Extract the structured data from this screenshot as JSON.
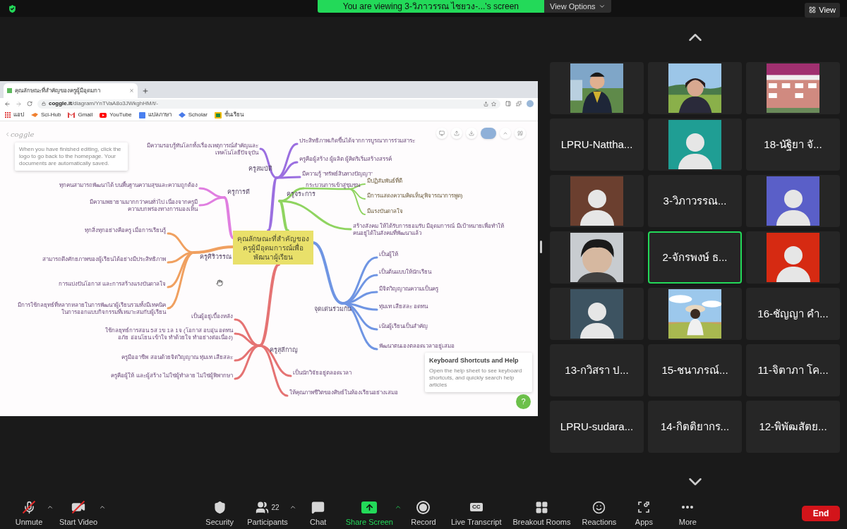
{
  "top_bar": {
    "banner": "You are viewing 3-วิภาวรรณ ไชยวง-...'s screen",
    "view_options": "View Options",
    "view": "View"
  },
  "browser": {
    "tab_title": "คุณลักษณะที่สำคัญของครูผู้มีอุดมกา",
    "url_host": "coggle.it",
    "url_path": "/diagram/YnTVaA8o3JWkghHM/t/-",
    "bookmarks": [
      {
        "kind": "apps",
        "label": "แอป"
      },
      {
        "kind": "scihub",
        "label": "Sci-Hub"
      },
      {
        "kind": "gmail",
        "label": "Gmail"
      },
      {
        "kind": "youtube",
        "label": "YouTube"
      },
      {
        "kind": "translate",
        "label": "แปลภาษา"
      },
      {
        "kind": "scholar",
        "label": "Scholar"
      },
      {
        "kind": "classroom",
        "label": "ชั้นเรียน"
      }
    ]
  },
  "coggle": {
    "logo": "coggle",
    "tip": "When you have finished editing, click the logo to go back to the homepage. Your documents are automatically saved.",
    "help_title": "Keyboard Shortcuts and Help",
    "help_text": "Open the help sheet to see keyboard shortcuts, and quickly search help articles",
    "help_button": "?",
    "center": "คุณลักษณะที่สำคัญของครูผู้มีอุดมการณ์เพื่อพัฒนาผู้เรียน",
    "branches": [
      {
        "label": "ครูสมบัติ",
        "color": "#9b6fe0",
        "children": [
          {
            "label": "มีความรอบรู้ทันโลกทั้งเรื่องเหตุการณ์สำคัญและเทคโนโลยีปัจจุบัน"
          },
          {
            "label": "ประสิทธิภาพเกิดขึ้นได้จากการบูรณาการร่วมสาระ"
          },
          {
            "label": "ครูคือผู้สร้าง ผู้ผลิต ผู้คิดริเริ่มสร้างสรรค์"
          },
          {
            "label": "มีความรู้ \"ทรัพย์สินทางปัญญา\""
          }
        ]
      },
      {
        "label": "ครูการดี",
        "color": "#e07ee0",
        "children": [
          {
            "label": "ทุกคนสามารถพัฒนาได้ บนพื้นฐานความสุขและความถูกต้อง"
          },
          {
            "label": "มีความพยายามมากกว่าคนทั่วไป เนื่องจากครูมีความบกพร่องทางการมองเห็น"
          }
        ]
      },
      {
        "label": "ครูศิริวรรณ",
        "color": "#f0a060",
        "children": [
          {
            "label": "ทุกสิ่งทุกอย่างคือครู เมื่อการเรียนรู้"
          },
          {
            "label": "สามารถดึงศักยภาพของผู้เรียนได้อย่างมีประสิทธิภาพ"
          },
          {
            "label": "การแบ่งปันโอกาส และการสร้างแรงบันดาลใจ"
          },
          {
            "label": "มีการใช้กลยุทธ์ที่หลากหลายในการพัฒนาผู้เรียนรวมทั้งมีเทคนิคในการออกแบบกิจกรรมที่เหมาะสมกับผู้เรียน"
          }
        ]
      },
      {
        "label": "ครูจระการ",
        "color": "#8fd460",
        "children": [
          {
            "label": "กระบวนการเข้าสู่ชุมชน",
            "children": [
              {
                "label": "มีปฏิสัมพันธ์ที่ดี"
              },
              {
                "label": "มีการแสดงความคิดเห็น(พิจารณาการพูด)"
              },
              {
                "label": "มีแรงบันดาลใจ"
              }
            ]
          },
          {
            "label": "สร้างสังคม ให้ได้รับการยอมรับ มีอุดมการณ์ มีเป้าหมายเพื่อทำให้คนอยู่ได้ในสังคมที่พัฒนาแล้ว"
          }
        ]
      },
      {
        "label": "จุดเด่นร่วมกัน",
        "color": "#6f95e3",
        "children": [
          {
            "label": "เป็นผู้ให้"
          },
          {
            "label": "เป็นต้นแบบให้นักเรียน"
          },
          {
            "label": "มีจิตวิญญาณความเป็นครู"
          },
          {
            "label": "ทุ่มเท เสียสละ อดทน"
          },
          {
            "label": "เน้นผู้เรียนเป็นสำคัญ"
          },
          {
            "label": "พัฒนาตนเองตลอดเวลาอยู่เสมอ"
          }
        ]
      },
      {
        "label": "ครูสุลีกาญ",
        "color": "#e57373",
        "children": [
          {
            "label": "เป็นผู้อยู่เบื้องหลัง"
          },
          {
            "label": "ใช้กลยุทธ์การสอน 5ส 1ข 1ล 1จ (โอกาส อบอุ่น อดทน อภัย อ่อนโยน เข้าใจ ทำด้วยใจ ทำอย่างต่อเนื่อง)"
          },
          {
            "label": "ครูมืออาชีพ สอนด้วยจิตวิญญาณ ทุ่มเท เสียสละ"
          },
          {
            "label": "ครูคือผู้ให้ และผู้สร้าง ไม่ใช่ผู้ทำลาย ไม่ใช่ผู้พิพากษา"
          },
          {
            "label": "เป็นนักวิจัยอยู่ตลอดเวลา"
          },
          {
            "label": "ให้คุณภาพชีวิตของศิษย์ในห้องเรียนอย่างเสมอ"
          }
        ]
      }
    ]
  },
  "participants": [
    {
      "kind": "video",
      "active": false
    },
    {
      "kind": "video",
      "active": false
    },
    {
      "kind": "video",
      "active": false
    },
    {
      "kind": "name",
      "name": "LPRU-Nattha...",
      "active": false
    },
    {
      "kind": "avatar",
      "color": "#1f9e94",
      "active": false
    },
    {
      "kind": "name",
      "name": "18-นัฐิยา จั...",
      "active": false
    },
    {
      "kind": "avatar",
      "color": "#6b3f2f",
      "active": false
    },
    {
      "kind": "name",
      "name": "3-วิภาวรรณ...",
      "active": false
    },
    {
      "kind": "avatar",
      "color": "#5a5fc8",
      "active": false
    },
    {
      "kind": "video",
      "active": false
    },
    {
      "kind": "name",
      "name": "2-จักรพงษ์ ธ...",
      "active": true
    },
    {
      "kind": "avatar",
      "color": "#d62a12",
      "active": false
    },
    {
      "kind": "avatar",
      "color": "#3d5361",
      "active": false
    },
    {
      "kind": "video",
      "active": false
    },
    {
      "kind": "name",
      "name": "16-ชัญญา คำ...",
      "active": false
    },
    {
      "kind": "name",
      "name": "13-กวิสรา ป...",
      "active": false
    },
    {
      "kind": "name",
      "name": "15-ชนาภรณ์...",
      "active": false
    },
    {
      "kind": "name",
      "name": "11-จิตาภา โค...",
      "active": false
    },
    {
      "kind": "name",
      "name": "LPRU-sudara...",
      "active": false
    },
    {
      "kind": "name",
      "name": "14-กิตติยากร...",
      "active": false
    },
    {
      "kind": "name",
      "name": "12-พิพัฒสัตย...",
      "active": false
    }
  ],
  "toolbar": {
    "items": [
      {
        "kind": "mic",
        "label": "Unmute",
        "off": true
      },
      {
        "kind": "video",
        "label": "Start Video",
        "off": true
      },
      {
        "kind": "security",
        "label": "Security"
      },
      {
        "kind": "participants",
        "label": "Participants",
        "count": "22"
      },
      {
        "kind": "chat",
        "label": "Chat"
      },
      {
        "kind": "share",
        "label": "Share Screen"
      },
      {
        "kind": "record",
        "label": "Record"
      },
      {
        "kind": "cc",
        "label": "Live Transcript",
        "badge": "CC"
      },
      {
        "kind": "breakout",
        "label": "Breakout Rooms"
      },
      {
        "kind": "reactions",
        "label": "Reactions"
      },
      {
        "kind": "apps",
        "label": "Apps"
      },
      {
        "kind": "more",
        "label": "More"
      }
    ],
    "end": "End"
  }
}
